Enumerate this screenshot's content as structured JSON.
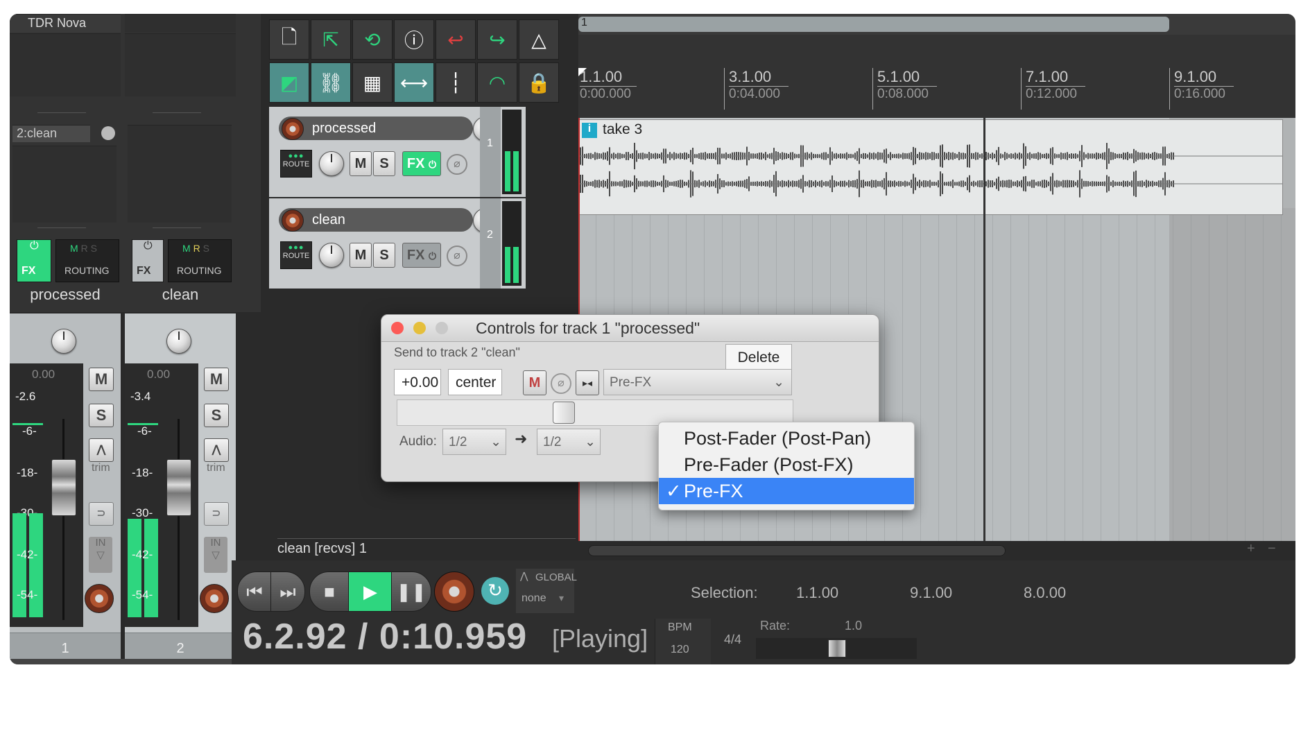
{
  "mixer": {
    "plugin_slot": "TDR Nova",
    "send_slot": "2:clean",
    "strips": [
      {
        "name": "processed",
        "fx_label": "FX",
        "routing_label": "ROUTING",
        "mrs": [
          "M",
          "R",
          "S"
        ],
        "peak": "0.00",
        "level": "-2.6",
        "number": "1",
        "fx_active": true
      },
      {
        "name": "clean",
        "fx_label": "FX",
        "routing_label": "ROUTING",
        "mrs": [
          "M",
          "R",
          "S"
        ],
        "peak": "0.00",
        "level": "-3.4",
        "number": "2",
        "fx_active": false
      }
    ],
    "scale": [
      "-6-",
      "-18-",
      "-30-",
      "-42-",
      "-54-"
    ],
    "mute": "M",
    "solo": "S",
    "trim": "trim",
    "in": "IN"
  },
  "tracks": [
    {
      "name": "processed",
      "route": "ROUTE",
      "mute": "M",
      "solo": "S",
      "fx": "FX",
      "number": "1"
    },
    {
      "name": "clean",
      "route": "ROUTE",
      "mute": "M",
      "solo": "S",
      "fx": "FX",
      "number": "2"
    }
  ],
  "tcp_footer": "clean [recvs] 1",
  "ruler": [
    {
      "bar": "1.1.00",
      "time": "0:00.000"
    },
    {
      "bar": "3.1.00",
      "time": "0:04.000"
    },
    {
      "bar": "5.1.00",
      "time": "0:08.000"
    },
    {
      "bar": "7.1.00",
      "time": "0:12.000"
    },
    {
      "bar": "9.1.00",
      "time": "0:16.000"
    }
  ],
  "region_marker": "1",
  "take_name": "take 3",
  "take_icon": "i",
  "dialog": {
    "title": "Controls for track 1 \"processed\"",
    "send_label": "Send to track 2 \"clean\"",
    "delete": "Delete",
    "volume": "+0.00",
    "pan": "center",
    "mute": "M",
    "mode": "Pre-FX",
    "audio_label": "Audio:",
    "src_channels": "1/2",
    "dst_channels": "1/2",
    "options": [
      "Post-Fader (Post-Pan)",
      "Pre-Fader (Post-FX)",
      "Pre-FX"
    ],
    "selected_check": "✓"
  },
  "transport": {
    "position": "6.2.92 / 0:10.959",
    "state": "[Playing]",
    "bpm_label": "BPM",
    "bpm": "120",
    "time_sig": "4/4",
    "global_label": "GLOBAL",
    "global_value": "none",
    "selection_label": "Selection:",
    "sel_start": "1.1.00",
    "sel_end": "9.1.00",
    "sel_length": "8.0.00",
    "rate_label": "Rate:",
    "rate": "1.0"
  },
  "colors": {
    "accent_green": "#2ed67f",
    "selection_blue": "#3a84f6",
    "teal": "#4fb3b3",
    "record_red": "#b0532f"
  }
}
